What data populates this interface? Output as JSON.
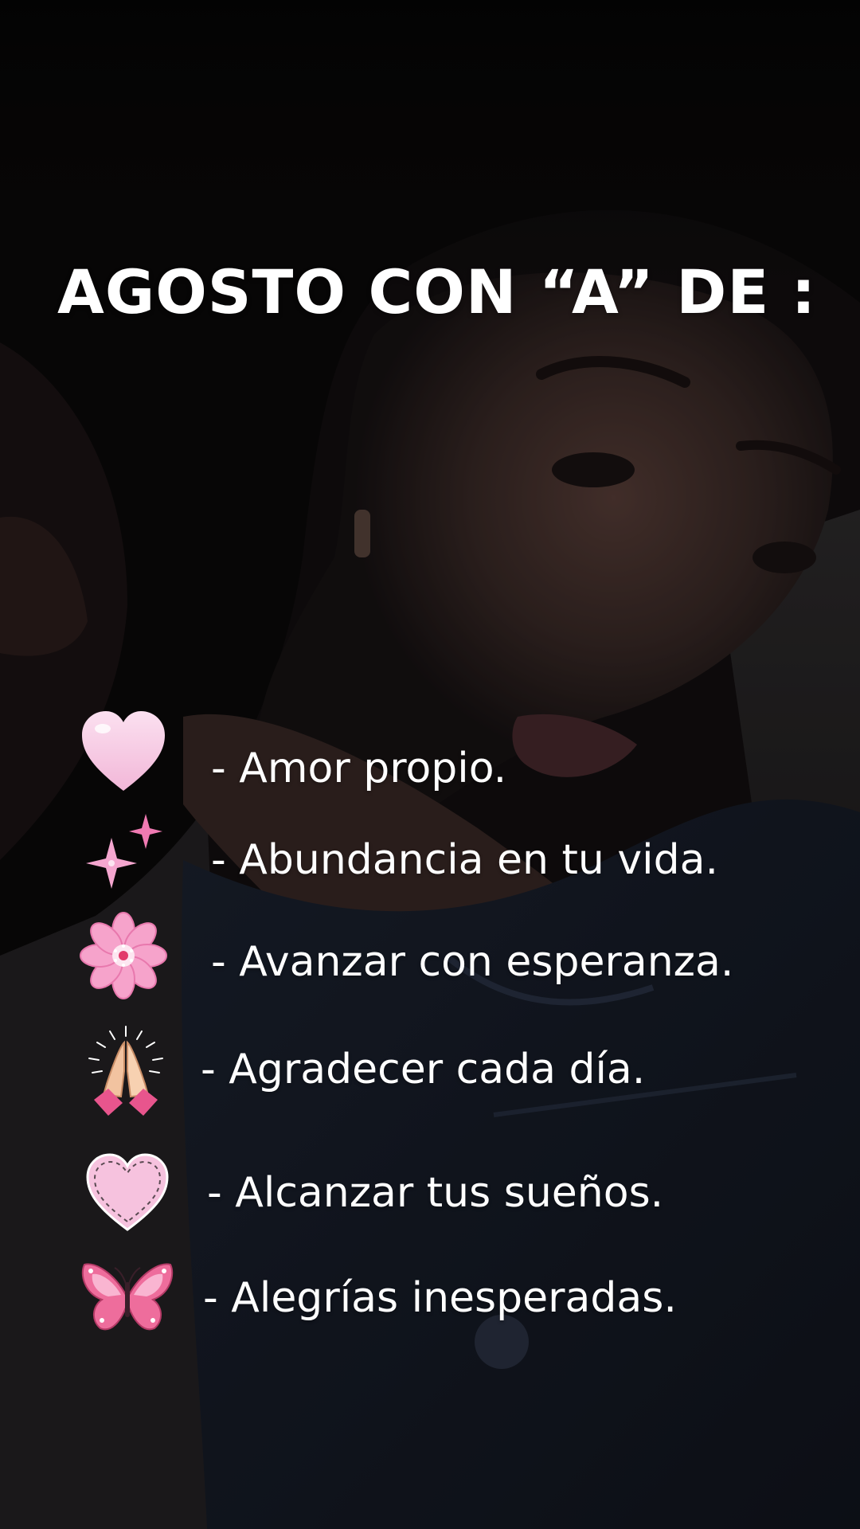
{
  "title": "AGOSTO CON “A” DE :",
  "items": [
    {
      "icon": "white-heart-icon",
      "text": "- Amor propio."
    },
    {
      "icon": "sparkles-icon",
      "text": "- Abundancia en tu vida."
    },
    {
      "icon": "cherry-blossom-icon",
      "text": "- Avanzar con esperanza."
    },
    {
      "icon": "praying-hands-icon",
      "text": "- Agradecer cada día."
    },
    {
      "icon": "stitched-heart-icon",
      "text": "- Alcanzar tus sueños."
    },
    {
      "icon": "butterfly-icon",
      "text": "- Alegrías inesperadas."
    }
  ],
  "colors": {
    "text": "#ffffff",
    "pink": "#f4a7cf",
    "pink_dark": "#e6709f",
    "background": "#1a1718"
  }
}
